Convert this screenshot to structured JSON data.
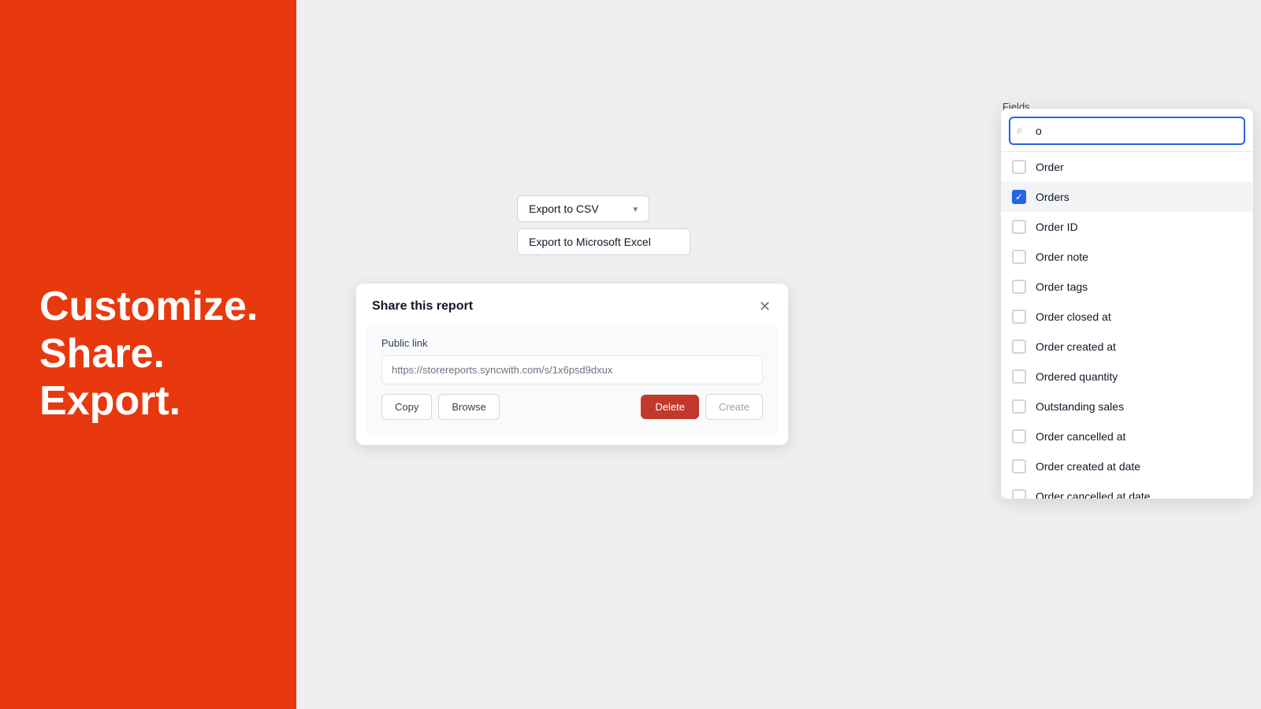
{
  "left_panel": {
    "hero_line1": "Customize.",
    "hero_line2": "Share.",
    "hero_line3": "Export.",
    "bg_color": "#e8390e"
  },
  "export_menu": {
    "csv_button_label": "Export to CSV",
    "excel_button_label": "Export to Microsoft Excel",
    "chevron": "▾"
  },
  "share_modal": {
    "title": "Share this report",
    "close_icon": "✕",
    "public_link_label": "Public link",
    "link_value": "https://storereports.syncwith.com/s/1x6psd9dxux",
    "copy_label": "Copy",
    "browse_label": "Browse",
    "delete_label": "Delete",
    "create_label": "Create"
  },
  "fields_panel": {
    "label": "Fields",
    "search_placeholder": "o",
    "search_value": "o",
    "search_icon": "🔍",
    "items": [
      {
        "id": "order",
        "label": "Order",
        "checked": false
      },
      {
        "id": "orders",
        "label": "Orders",
        "checked": true
      },
      {
        "id": "order-id",
        "label": "Order ID",
        "checked": false
      },
      {
        "id": "order-note",
        "label": "Order note",
        "checked": false
      },
      {
        "id": "order-tags",
        "label": "Order tags",
        "checked": false
      },
      {
        "id": "order-closed-at",
        "label": "Order closed at",
        "checked": false
      },
      {
        "id": "order-created-at",
        "label": "Order created at",
        "checked": false
      },
      {
        "id": "ordered-quantity",
        "label": "Ordered quantity",
        "checked": false
      },
      {
        "id": "outstanding-sales",
        "label": "Outstanding sales",
        "checked": false
      },
      {
        "id": "order-cancelled-at",
        "label": "Order cancelled at",
        "checked": false
      },
      {
        "id": "order-created-at-date",
        "label": "Order created at date",
        "checked": false
      },
      {
        "id": "order-cancelled-at-date",
        "label": "Order cancelled at date",
        "checked": false
      }
    ]
  }
}
